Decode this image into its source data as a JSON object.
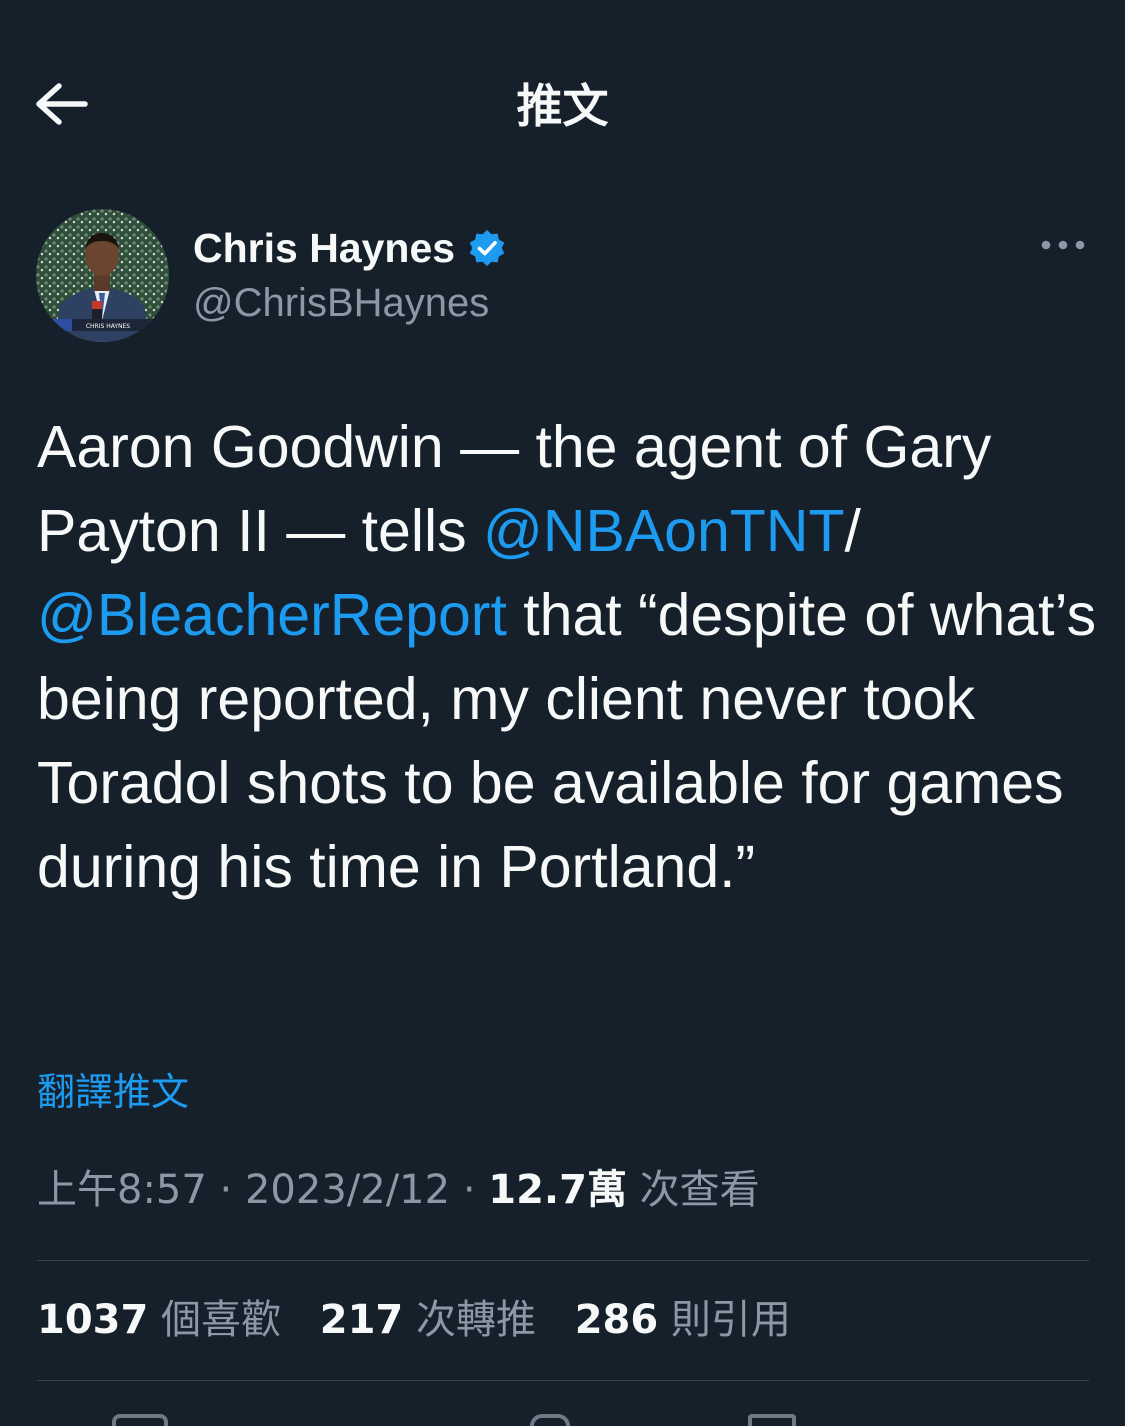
{
  "header": {
    "title": "推文",
    "back_icon": "arrow-left-icon"
  },
  "author": {
    "name": "Chris Haynes",
    "handle": "@ChrisBHaynes",
    "verified_icon": "verified-badge-icon",
    "verified_color": "#1d9bf0",
    "avatar_caption": "CHRIS HAYNES"
  },
  "more_icon": "more-horizontal-icon",
  "tweet": {
    "segments": [
      {
        "type": "text",
        "value": "Aaron Goodwin — the agent of Gary Payton II — tells "
      },
      {
        "type": "mention",
        "value": "@NBAonTNT"
      },
      {
        "type": "text",
        "value": "/ "
      },
      {
        "type": "mention",
        "value": "@BleacherReport"
      },
      {
        "type": "text",
        "value": " that “despite of what’s being reported, my client never took Toradol shots to be available for games during his time in Portland.”"
      }
    ]
  },
  "translate_label": "翻譯推文",
  "meta": {
    "time": "上午8:57",
    "separator": "·",
    "date": "2023/2/12",
    "views_count": "12.7萬",
    "views_label": "次查看"
  },
  "stats": [
    {
      "count": "1037",
      "label": "個喜歡"
    },
    {
      "count": "217",
      "label": "次轉推"
    },
    {
      "count": "286",
      "label": "則引用"
    }
  ],
  "colors": {
    "background": "#15202b",
    "text_primary": "#f7f9f9",
    "text_secondary": "#8b98a5",
    "accent": "#1d9bf0",
    "divider": "#38444d"
  }
}
